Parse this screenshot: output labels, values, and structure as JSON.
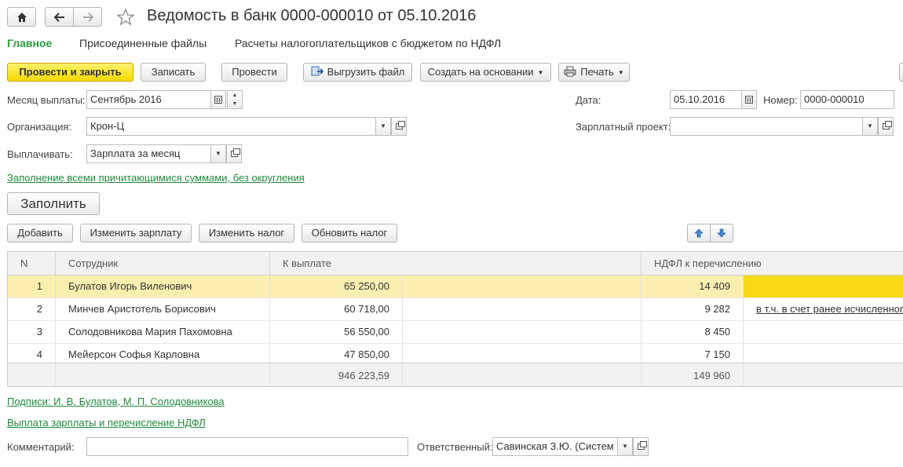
{
  "window": {
    "title": "Ведомость в банк 0000-000010 от 05.10.2016"
  },
  "tabs": [
    "Главное",
    "Присоединенные файлы",
    "Расчеты налогоплательщиков с бюджетом по НДФЛ"
  ],
  "toolbar": {
    "post_close": "Провести и закрыть",
    "save": "Записать",
    "post": "Провести",
    "export": "Выгрузить файл",
    "create_based": "Создать на основании",
    "print": "Печать"
  },
  "form": {
    "month_label": "Месяц выплаты:",
    "month_value": "Сентябрь 2016",
    "date_label": "Дата:",
    "date_value": "05.10.2016",
    "number_label": "Номер:",
    "number_value": "0000-000010",
    "org_label": "Организация:",
    "org_value": "Крон-Ц",
    "salary_project_label": "Зарплатный проект:",
    "salary_project_value": "",
    "pay_label": "Выплачивать:",
    "pay_value": "Зарплата за месяц",
    "fill_mode_link": "Заполнение всеми причитающимися суммами, без округления",
    "fill_button": "Заполнить"
  },
  "table_toolbar": {
    "add": "Добавить",
    "change_salary": "Изменить зарплату",
    "change_tax": "Изменить налог",
    "update_tax": "Обновить налог"
  },
  "table": {
    "headers": {
      "n": "N",
      "employee": "Сотрудник",
      "pay": "К выплате",
      "ndfl": "НДФЛ к перечислению"
    },
    "rows": [
      {
        "n": "1",
        "employee": "Булатов Игорь Виленович",
        "pay": "65 250,00",
        "ndfl": "14 409",
        "note": ""
      },
      {
        "n": "2",
        "employee": "Минчев Аристотель Борисович",
        "pay": "60 718,00",
        "ndfl": "9 282",
        "note": "в т.ч. в счет ранее исчисленного"
      },
      {
        "n": "3",
        "employee": "Солодовникова Мария Пахомовна",
        "pay": "56 550,00",
        "ndfl": "8 450",
        "note": ""
      },
      {
        "n": "4",
        "employee": "Мейерсон Софья Карловна",
        "pay": "47 850,00",
        "ndfl": "7 150",
        "note": ""
      }
    ],
    "totals": {
      "pay": "946 223,59",
      "ndfl": "149 960"
    }
  },
  "links": {
    "signatures": "Подписи: И. В. Булатов, М. П. Солодовникова",
    "payment": "Выплата зарплаты и перечисление НДФЛ"
  },
  "bottom": {
    "comment_label": "Комментарий:",
    "comment_value": "",
    "responsible_label": "Ответственный:",
    "responsible_value": "Савинская З.Ю. (Систем"
  },
  "colors": {
    "accent_green": "#2c9a3e",
    "primary_yellow": "#f3d800",
    "selected_row": "#fbefb0"
  }
}
